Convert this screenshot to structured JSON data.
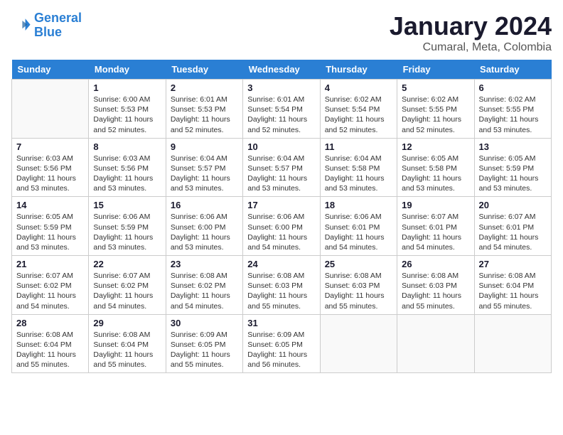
{
  "logo": {
    "line1": "General",
    "line2": "Blue"
  },
  "title": "January 2024",
  "subtitle": "Cumaral, Meta, Colombia",
  "weekdays": [
    "Sunday",
    "Monday",
    "Tuesday",
    "Wednesday",
    "Thursday",
    "Friday",
    "Saturday"
  ],
  "weeks": [
    [
      {
        "num": "",
        "info": ""
      },
      {
        "num": "1",
        "info": "Sunrise: 6:00 AM\nSunset: 5:53 PM\nDaylight: 11 hours\nand 52 minutes."
      },
      {
        "num": "2",
        "info": "Sunrise: 6:01 AM\nSunset: 5:53 PM\nDaylight: 11 hours\nand 52 minutes."
      },
      {
        "num": "3",
        "info": "Sunrise: 6:01 AM\nSunset: 5:54 PM\nDaylight: 11 hours\nand 52 minutes."
      },
      {
        "num": "4",
        "info": "Sunrise: 6:02 AM\nSunset: 5:54 PM\nDaylight: 11 hours\nand 52 minutes."
      },
      {
        "num": "5",
        "info": "Sunrise: 6:02 AM\nSunset: 5:55 PM\nDaylight: 11 hours\nand 52 minutes."
      },
      {
        "num": "6",
        "info": "Sunrise: 6:02 AM\nSunset: 5:55 PM\nDaylight: 11 hours\nand 53 minutes."
      }
    ],
    [
      {
        "num": "7",
        "info": "Sunrise: 6:03 AM\nSunset: 5:56 PM\nDaylight: 11 hours\nand 53 minutes."
      },
      {
        "num": "8",
        "info": "Sunrise: 6:03 AM\nSunset: 5:56 PM\nDaylight: 11 hours\nand 53 minutes."
      },
      {
        "num": "9",
        "info": "Sunrise: 6:04 AM\nSunset: 5:57 PM\nDaylight: 11 hours\nand 53 minutes."
      },
      {
        "num": "10",
        "info": "Sunrise: 6:04 AM\nSunset: 5:57 PM\nDaylight: 11 hours\nand 53 minutes."
      },
      {
        "num": "11",
        "info": "Sunrise: 6:04 AM\nSunset: 5:58 PM\nDaylight: 11 hours\nand 53 minutes."
      },
      {
        "num": "12",
        "info": "Sunrise: 6:05 AM\nSunset: 5:58 PM\nDaylight: 11 hours\nand 53 minutes."
      },
      {
        "num": "13",
        "info": "Sunrise: 6:05 AM\nSunset: 5:59 PM\nDaylight: 11 hours\nand 53 minutes."
      }
    ],
    [
      {
        "num": "14",
        "info": "Sunrise: 6:05 AM\nSunset: 5:59 PM\nDaylight: 11 hours\nand 53 minutes."
      },
      {
        "num": "15",
        "info": "Sunrise: 6:06 AM\nSunset: 5:59 PM\nDaylight: 11 hours\nand 53 minutes."
      },
      {
        "num": "16",
        "info": "Sunrise: 6:06 AM\nSunset: 6:00 PM\nDaylight: 11 hours\nand 53 minutes."
      },
      {
        "num": "17",
        "info": "Sunrise: 6:06 AM\nSunset: 6:00 PM\nDaylight: 11 hours\nand 54 minutes."
      },
      {
        "num": "18",
        "info": "Sunrise: 6:06 AM\nSunset: 6:01 PM\nDaylight: 11 hours\nand 54 minutes."
      },
      {
        "num": "19",
        "info": "Sunrise: 6:07 AM\nSunset: 6:01 PM\nDaylight: 11 hours\nand 54 minutes."
      },
      {
        "num": "20",
        "info": "Sunrise: 6:07 AM\nSunset: 6:01 PM\nDaylight: 11 hours\nand 54 minutes."
      }
    ],
    [
      {
        "num": "21",
        "info": "Sunrise: 6:07 AM\nSunset: 6:02 PM\nDaylight: 11 hours\nand 54 minutes."
      },
      {
        "num": "22",
        "info": "Sunrise: 6:07 AM\nSunset: 6:02 PM\nDaylight: 11 hours\nand 54 minutes."
      },
      {
        "num": "23",
        "info": "Sunrise: 6:08 AM\nSunset: 6:02 PM\nDaylight: 11 hours\nand 54 minutes."
      },
      {
        "num": "24",
        "info": "Sunrise: 6:08 AM\nSunset: 6:03 PM\nDaylight: 11 hours\nand 55 minutes."
      },
      {
        "num": "25",
        "info": "Sunrise: 6:08 AM\nSunset: 6:03 PM\nDaylight: 11 hours\nand 55 minutes."
      },
      {
        "num": "26",
        "info": "Sunrise: 6:08 AM\nSunset: 6:03 PM\nDaylight: 11 hours\nand 55 minutes."
      },
      {
        "num": "27",
        "info": "Sunrise: 6:08 AM\nSunset: 6:04 PM\nDaylight: 11 hours\nand 55 minutes."
      }
    ],
    [
      {
        "num": "28",
        "info": "Sunrise: 6:08 AM\nSunset: 6:04 PM\nDaylight: 11 hours\nand 55 minutes."
      },
      {
        "num": "29",
        "info": "Sunrise: 6:08 AM\nSunset: 6:04 PM\nDaylight: 11 hours\nand 55 minutes."
      },
      {
        "num": "30",
        "info": "Sunrise: 6:09 AM\nSunset: 6:05 PM\nDaylight: 11 hours\nand 55 minutes."
      },
      {
        "num": "31",
        "info": "Sunrise: 6:09 AM\nSunset: 6:05 PM\nDaylight: 11 hours\nand 56 minutes."
      },
      {
        "num": "",
        "info": ""
      },
      {
        "num": "",
        "info": ""
      },
      {
        "num": "",
        "info": ""
      }
    ]
  ]
}
